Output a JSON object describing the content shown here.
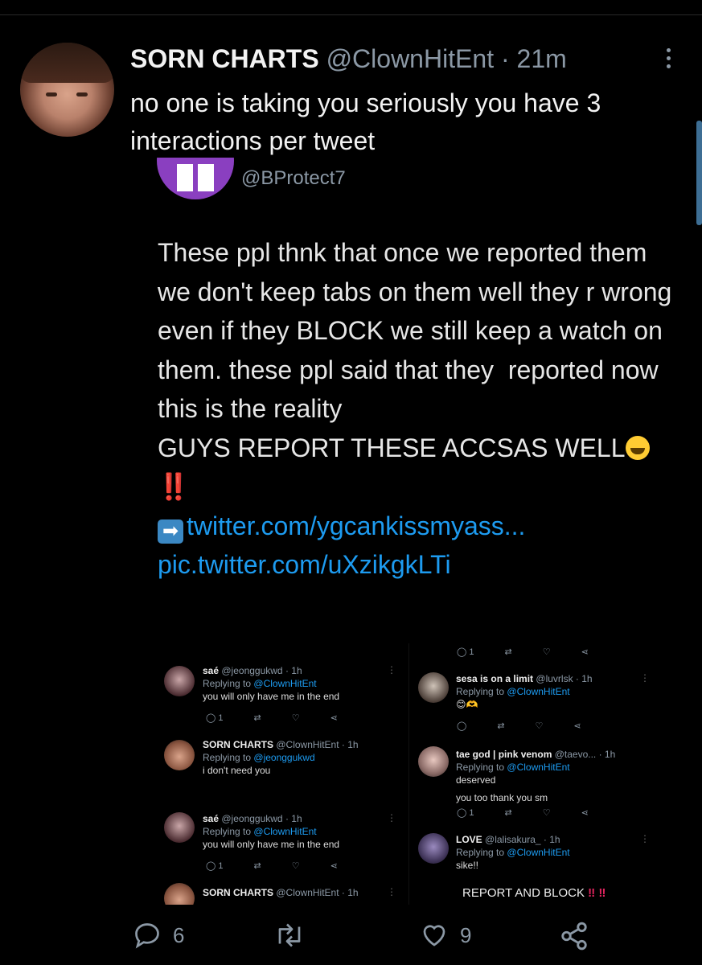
{
  "tweet": {
    "display_name": "SORN CHARTS",
    "handle": "@ClownHitEnt",
    "separator": "·",
    "time": "21m",
    "text": "no one is taking you seriously you have 3 interactions per tweet"
  },
  "quoted": {
    "handle": "@BProtect7",
    "body": "These ppl thnk that once we reported them we don't keep tabs on them well they r wrong even if they BLOCK we still keep a watch on them. these ppl said that they  reported now this is the reality\nGUYS REPORT THESE ACCSAS WELL",
    "bangs": "‼️",
    "link1": "twitter.com/ygcankissmyass...",
    "link2": "pic.twitter.com/uXzikgkLTi"
  },
  "embedded": {
    "left": [
      {
        "name": "saé",
        "handle": "@jeonggukwd · 1h",
        "replying": "Replying to",
        "to": "@ClownHitEnt",
        "text": "you will only have me in the end",
        "replies": "1"
      },
      {
        "name": "SORN CHARTS",
        "handle": "@ClownHitEnt · 1h",
        "replying": "Replying to",
        "to": "@jeonggukwd",
        "text": "i don't need you"
      },
      {
        "name": "saé",
        "handle": "@jeonggukwd · 1h",
        "replying": "Replying to",
        "to": "@ClownHitEnt",
        "text": "you will only have me in the end",
        "replies": "1"
      },
      {
        "name": "SORN CHARTS",
        "handle": "@ClownHitEnt · 1h"
      }
    ],
    "right": [
      {
        "name": "sesa is on a limit",
        "handle": "@luvrlsk · 1h",
        "replying": "Replying to",
        "to": "@ClownHitEnt"
      },
      {
        "name": "tae god | pink venom",
        "handle": "@taevo... · 1h",
        "replying": "Replying to",
        "to": "@ClownHitEnt",
        "text": "deserved"
      },
      {
        "name": "LOVE",
        "handle": "@lalisakura_ · 1h",
        "replying": "Replying to",
        "to": "@ClownHitEnt",
        "text": "sike!!",
        "report": "REPORT AND BLOCK"
      }
    ],
    "peek_text": "you too",
    "peek_text2": "thank you sm",
    "reply_count": "1"
  },
  "actions": {
    "replies": "6",
    "likes": "9"
  },
  "icons": [
    "reply-icon",
    "retweet-icon",
    "like-icon",
    "share-icon",
    "more-icon"
  ],
  "colors": {
    "accent": "#1d9bf0",
    "muted": "#8b98a5",
    "bg": "#000000"
  }
}
